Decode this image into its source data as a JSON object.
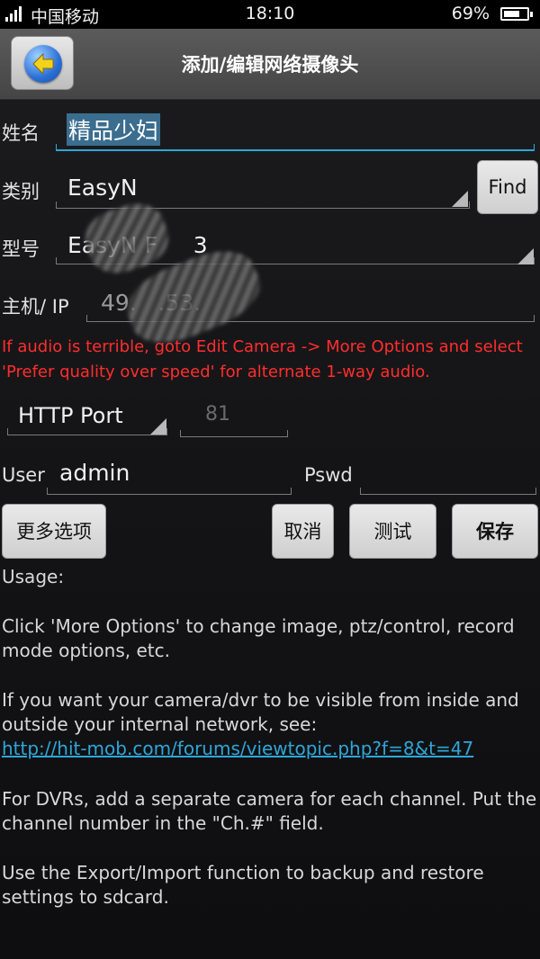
{
  "status_bar": {
    "carrier": "中国移动",
    "time": "18:10",
    "battery": "69%",
    "battery_level": 0.69
  },
  "header": {
    "title": "添加/编辑网络摄像头"
  },
  "form": {
    "name_label": "姓名",
    "name_value": "精品少妇",
    "type_label": "类别",
    "type_value": "EasyN",
    "find_button": "Find",
    "model_label": "型号",
    "model_value": "EasyN F     3",
    "host_label": "主机/ IP",
    "host_value": "49.   .53.",
    "warning": "If audio is terrible, goto Edit Camera -> More Options and select 'Prefer quality over speed' for alternate 1-way audio.",
    "port_type": "HTTP Port",
    "port_value": "81",
    "user_label": "User",
    "user_value": "admin",
    "pswd_label": "Pswd",
    "pswd_value": ""
  },
  "buttons": {
    "more_options": "更多选项",
    "cancel": "取消",
    "test": "测试",
    "save": "保存"
  },
  "usage": {
    "heading": "Usage:",
    "p1": "Click 'More Options' to change image, ptz/control, record mode options, etc.",
    "p2": "If you want your camera/dvr to be visible from inside and outside your internal network, see:",
    "link": "http://hit-mob.com/forums/viewtopic.php?f=8&t=47",
    "p3": "For DVRs, add a separate camera for each channel. Put the channel number in the \"Ch.#\" field.",
    "p4": "Use the Export/Import function to backup and restore settings to sdcard."
  },
  "colors": {
    "warning": "#ff2d2d",
    "accent": "#2fa6d8",
    "title_bar": "#4f4f4f"
  }
}
